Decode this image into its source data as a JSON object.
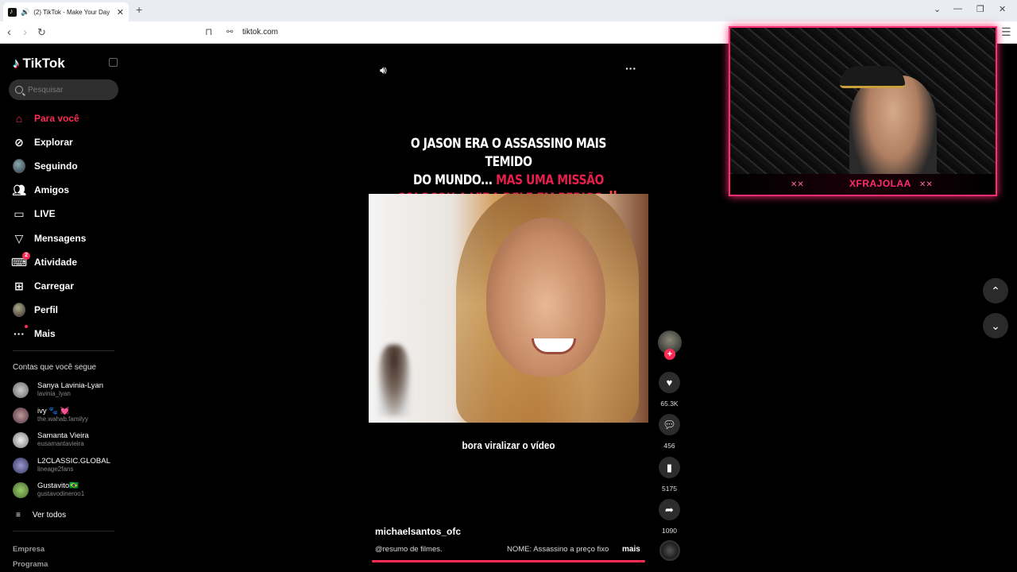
{
  "browser": {
    "tab_title": "(2) TikTok - Make Your Day",
    "url": "tiktok.com"
  },
  "sidebar": {
    "logo": "TikTok",
    "search_placeholder": "Pesquisar",
    "nav": [
      {
        "label": "Para você",
        "icon": "home-icon",
        "active": true
      },
      {
        "label": "Explorar",
        "icon": "compass-icon"
      },
      {
        "label": "Seguindo",
        "icon": "following-avatar"
      },
      {
        "label": "Amigos",
        "icon": "friends-icon"
      },
      {
        "label": "LIVE",
        "icon": "live-icon"
      },
      {
        "label": "Mensagens",
        "icon": "messages-icon"
      },
      {
        "label": "Atividade",
        "icon": "activity-icon",
        "badge": "2"
      },
      {
        "label": "Carregar",
        "icon": "upload-icon"
      },
      {
        "label": "Perfil",
        "icon": "profile-avatar"
      },
      {
        "label": "Mais",
        "icon": "more-icon"
      }
    ],
    "following_title": "Contas que você segue",
    "accounts": [
      {
        "name": "Sanya Lavinia-Lyan",
        "username": "lavinia_lyan"
      },
      {
        "name": "ivy 🐾 💓",
        "username": "the.wahab.familyy"
      },
      {
        "name": "Samanta Vieira",
        "username": "eusamantavieira"
      },
      {
        "name": "L2CLASSIC.GLOBAL",
        "username": "lineage2fans"
      },
      {
        "name": "Gustavito🇧🇷",
        "username": "gustavodineroo1"
      }
    ],
    "see_all": "Ver todos",
    "footer": [
      "Empresa",
      "Programa"
    ]
  },
  "video": {
    "headline_white_1": "O JASON ERA O ASSASSINO MAIS TEMIDO",
    "headline_white_2": "DO MUNDO...",
    "headline_red_2": "MAS UMA MISSÃO",
    "headline_red_3": "COLOCOU A VIDA DELE EM PERIGO ‼️",
    "caption": "bora viralizar o vídeo",
    "author": "michaelsantos_ofc",
    "description": "@resumo de filmes.",
    "name_tag": "NOME: Assassino a preço fixo",
    "more": "mais",
    "progress": 1.0
  },
  "actions": {
    "likes": "65.3K",
    "comments": "456",
    "saves": "5175",
    "shares": "1090"
  },
  "webcam": {
    "streamer_name": "XFRAJOLAA"
  },
  "colors": {
    "accent": "#fe2c55",
    "cam_border": "#ff2d6f"
  }
}
